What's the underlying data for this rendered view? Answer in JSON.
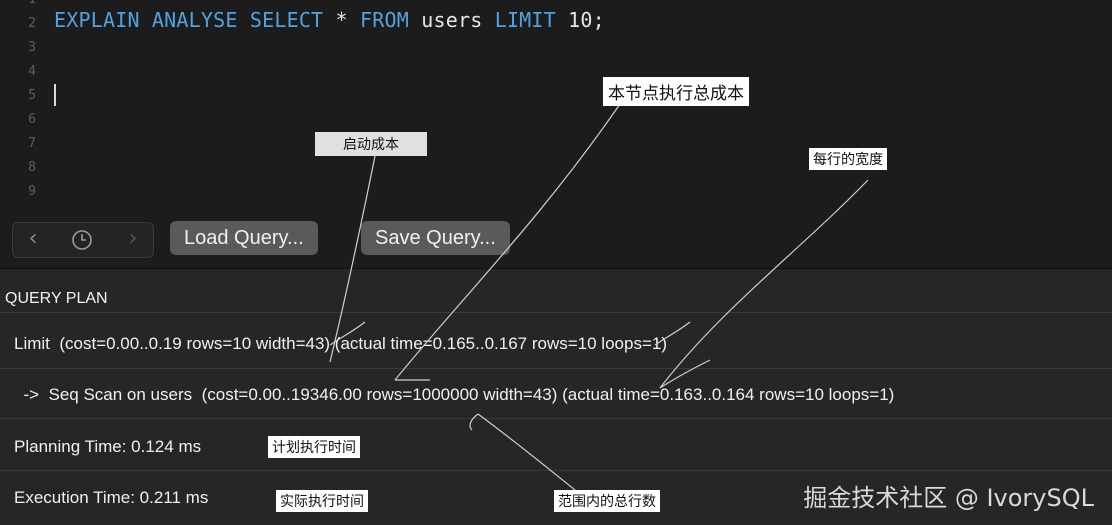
{
  "editor": {
    "line_numbers": [
      "1",
      "2",
      "3",
      "4",
      "5",
      "6",
      "7",
      "8",
      "9"
    ],
    "code": {
      "kw1": "EXPLAIN ANALYSE SELECT",
      "star": " * ",
      "kw2": "FROM",
      "ident": " users ",
      "kw3": "LIMIT",
      "tail": " 10;"
    }
  },
  "toolbar": {
    "back_icon": "chevron-left-icon",
    "history_icon": "clock-icon",
    "forward_icon": "chevron-right-icon",
    "load_label": "Load Query...",
    "save_label": "Save Query..."
  },
  "plan": {
    "header": "QUERY PLAN",
    "rows": [
      "Limit  (cost=0.00..0.19 rows=10 width=43) (actual time=0.165..0.167 rows=10 loops=1)",
      "  ->  Seq Scan on users  (cost=0.00..19346.00 rows=1000000 width=43) (actual time=0.163..0.164 rows=10 loops=1)",
      "Planning Time: 0.124 ms",
      "Execution Time: 0.211 ms"
    ]
  },
  "annotations": {
    "startup_cost": "启动成本",
    "total_cost": "本节点执行总成本",
    "row_width": "每行的宽度",
    "planning_time": "计划执行时间",
    "execution_time": "实际执行时间",
    "total_rows": "范围内的总行数"
  },
  "watermark": "掘金技术社区 @ IvorySQL",
  "colors": {
    "keyword": "#4fa3e3",
    "background": "#1c1c1c",
    "button": "#5a5a5a"
  }
}
